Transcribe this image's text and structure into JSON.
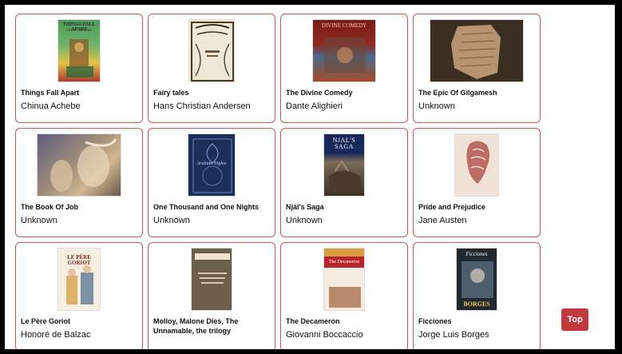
{
  "books": [
    {
      "title": "Things Fall Apart",
      "author": "Chinua Achebe",
      "cover_text": "THINGS FALL APART",
      "cover_sub": "CHINUA ACHEBE"
    },
    {
      "title": "Fairy tales",
      "author": "Hans Christian Andersen",
      "cover_text": "",
      "cover_sub": ""
    },
    {
      "title": "The Divine Comedy",
      "author": "Dante Alighieri",
      "cover_text": "DIVINE COMEDY",
      "cover_sub": ""
    },
    {
      "title": "The Epic Of Gilgamesh",
      "author": "Unknown",
      "cover_text": "",
      "cover_sub": ""
    },
    {
      "title": "The Book Of Job",
      "author": "Unknown",
      "cover_text": "",
      "cover_sub": ""
    },
    {
      "title": "One Thousand and One Nights",
      "author": "Unknown",
      "cover_text": "Arabian Nights",
      "cover_sub": ""
    },
    {
      "title": "Njál's Saga",
      "author": "Unknown",
      "cover_text": "NJAL'S SAGA",
      "cover_sub": ""
    },
    {
      "title": "Pride and Prejudice",
      "author": "Jane Austen",
      "cover_text": "",
      "cover_sub": ""
    },
    {
      "title": "Le Père Goriot",
      "author": "Honoré de Balzac",
      "cover_text": "LE PÈRE GORIOT",
      "cover_sub": ""
    },
    {
      "title": "Molloy, Malone Dies, The Unnamable, the trilogy",
      "author": "",
      "cover_text": "",
      "cover_sub": ""
    },
    {
      "title": "The Decameron",
      "author": "Giovanni Boccaccio",
      "cover_text": "The Decameron",
      "cover_sub": ""
    },
    {
      "title": "Ficciones",
      "author": "Jorge Luis Borges",
      "cover_text": "Ficciones",
      "cover_sub": "BORGES"
    }
  ],
  "top_button": {
    "label": "Top"
  },
  "colors": {
    "card_border": "#c9555b",
    "top_button": "#c0393f"
  }
}
